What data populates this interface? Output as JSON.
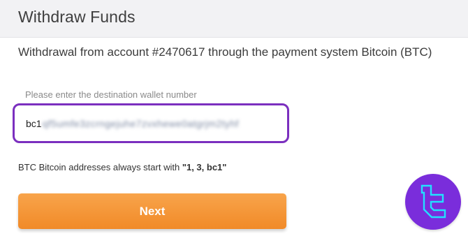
{
  "header": {
    "title": "Withdraw Funds"
  },
  "main": {
    "subtitle": "Withdrawal from account #2470617 through the payment system Bitcoin (BTC)",
    "wallet_field": {
      "label": "Please enter the destination wallet number",
      "value_prefix": "bc1",
      "value_redacted": "qf5umfe3zcrngejuhe7zvxhewe0atgrjm2tyhf"
    },
    "hint": {
      "text": "BTC Bitcoin addresses always start with ",
      "emphasis": "\"1, 3, bc1\""
    },
    "next_button_label": "Next"
  },
  "watermark": {
    "icon": "brand-logo-icon",
    "color": "#7a2ddb",
    "accent": "#22e0ff"
  },
  "colors": {
    "focus_border": "#7b2fbf",
    "button": "#f39233"
  }
}
